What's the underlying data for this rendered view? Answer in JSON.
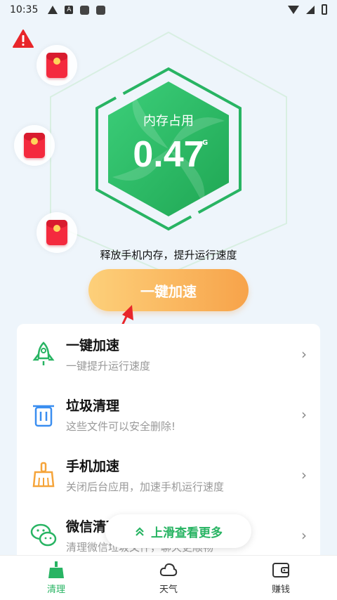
{
  "status_bar": {
    "time": "10:35",
    "a_badge": "A"
  },
  "hero": {
    "memory_label": "内存占用",
    "memory_value": "0.47",
    "memory_unit": "G",
    "subtitle": "释放手机内存，提升运行速度",
    "boost_button": "一键加速"
  },
  "features": [
    {
      "title": "一键加速",
      "desc": "一键提升运行速度",
      "icon": "rocket-icon"
    },
    {
      "title": "垃圾清理",
      "desc": "这些文件可以安全删除!",
      "icon": "trash-icon"
    },
    {
      "title": "手机加速",
      "desc": "关闭后台应用，加速手机运行速度",
      "icon": "broom-icon"
    },
    {
      "title": "微信清理",
      "desc": "清理微信垃圾文件，聊天更顺畅",
      "icon": "wechat-icon"
    }
  ],
  "more_pill": {
    "label": "上滑查看更多"
  },
  "bottom_nav": [
    {
      "label": "清理",
      "icon": "broom-icon",
      "active": true
    },
    {
      "label": "天气",
      "icon": "cloud-icon",
      "active": false
    },
    {
      "label": "赚钱",
      "icon": "wallet-icon",
      "active": false
    }
  ],
  "colors": {
    "accent": "#28b463",
    "button_start": "#fdd07a",
    "button_end": "#f7a34a",
    "envelope": "#f42a3e"
  }
}
